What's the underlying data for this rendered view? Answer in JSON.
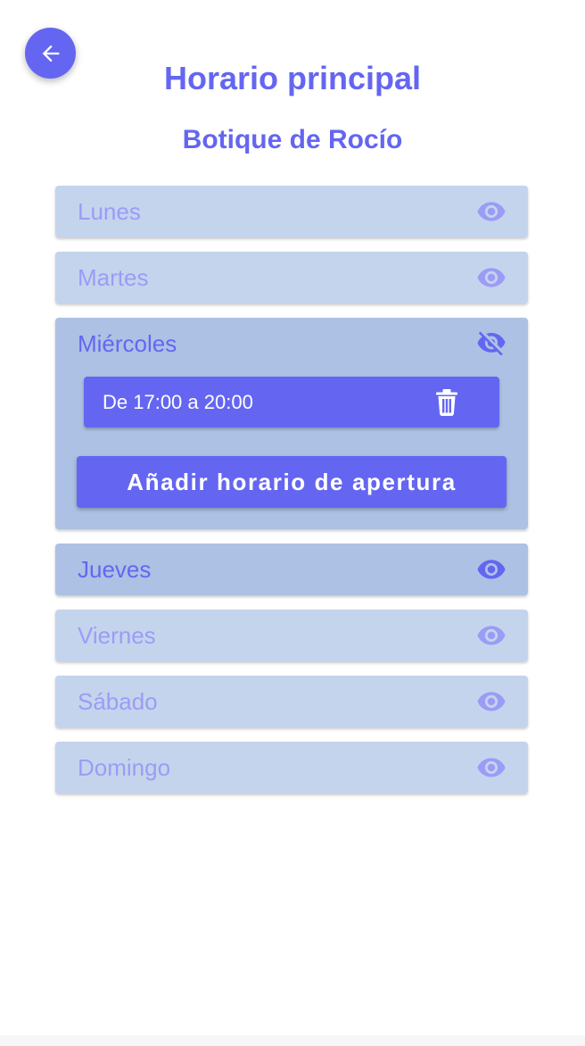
{
  "header": {
    "title": "Horario principal",
    "subtitle": "Botique de Rocío"
  },
  "colors": {
    "accent": "#6466f1",
    "card": "#c5d4ed",
    "card_active": "#adc1e4",
    "muted_text": "#9b9cf6"
  },
  "days": [
    {
      "label": "Lunes",
      "icon": "eye-icon",
      "active": false
    },
    {
      "label": "Martes",
      "icon": "eye-icon",
      "active": false
    },
    {
      "label": "Miércoles",
      "icon": "eye-off-icon",
      "active": true,
      "slots": [
        {
          "text": "De 17:00 a 20:00",
          "icon": "trash-icon"
        }
      ],
      "add_button": "Añadir horario de apertura"
    },
    {
      "label": "Jueves",
      "icon": "eye-icon",
      "active": true
    },
    {
      "label": "Viernes",
      "icon": "eye-icon",
      "active": false
    },
    {
      "label": "Sábado",
      "icon": "eye-icon",
      "active": false
    },
    {
      "label": "Domingo",
      "icon": "eye-icon",
      "active": false
    }
  ]
}
